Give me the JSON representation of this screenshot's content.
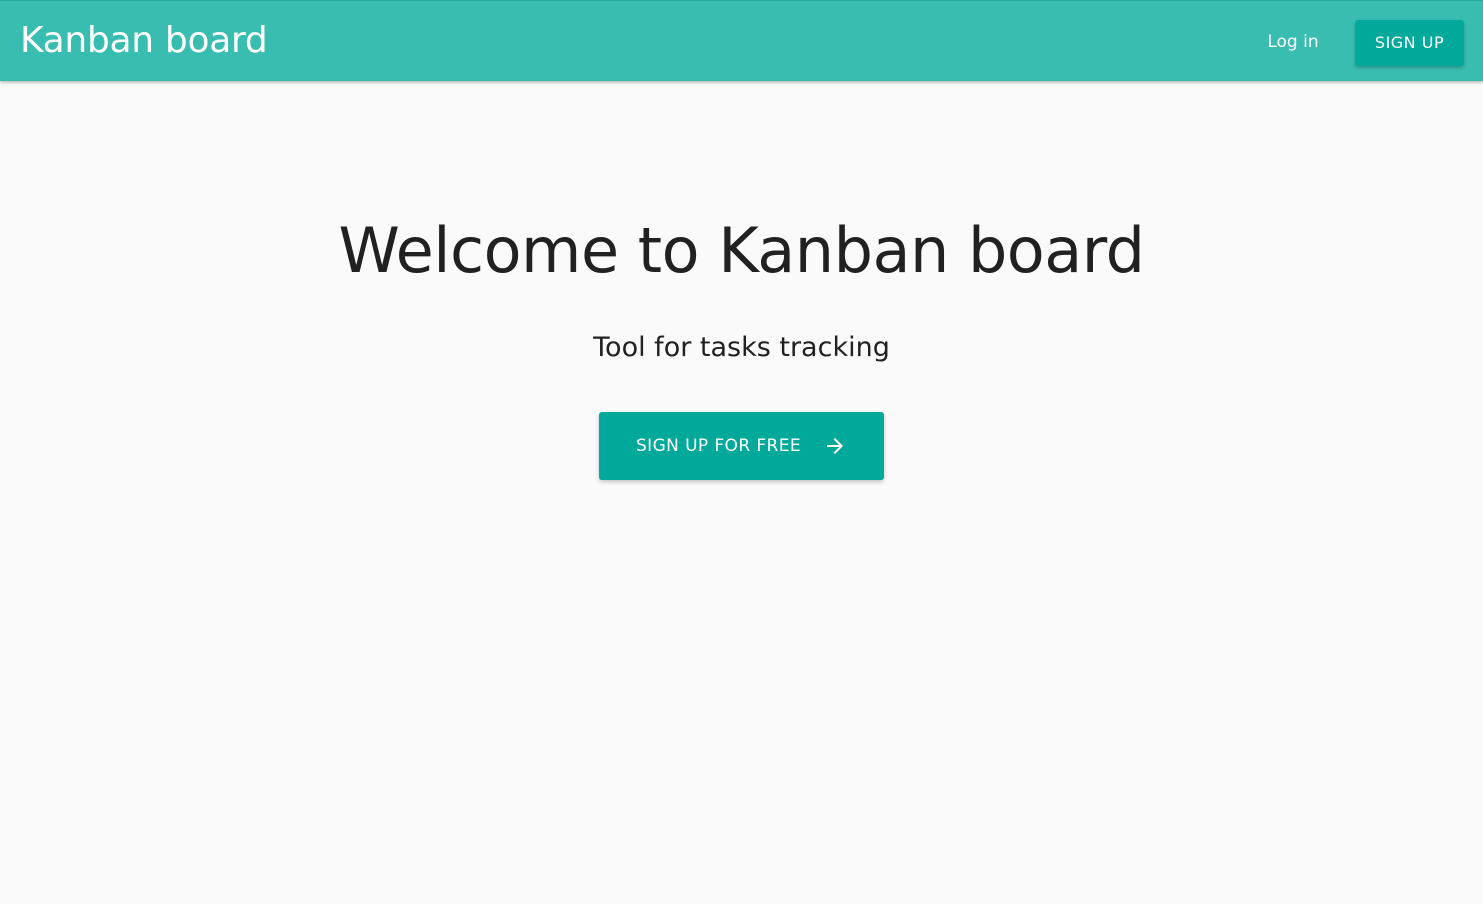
{
  "header": {
    "brand": "Kanban board",
    "login_label": "Log in",
    "signup_label": "SIGN UP"
  },
  "hero": {
    "title": "Welcome to Kanban board",
    "subtitle": "Tool for tasks tracking",
    "cta_label": "SIGN UP FOR FREE",
    "cta_icon": "arrow-right-icon"
  },
  "colors": {
    "app_bar": "#38bdb0",
    "accent": "#00a99a",
    "background": "#fafafa",
    "text": "#212121"
  }
}
